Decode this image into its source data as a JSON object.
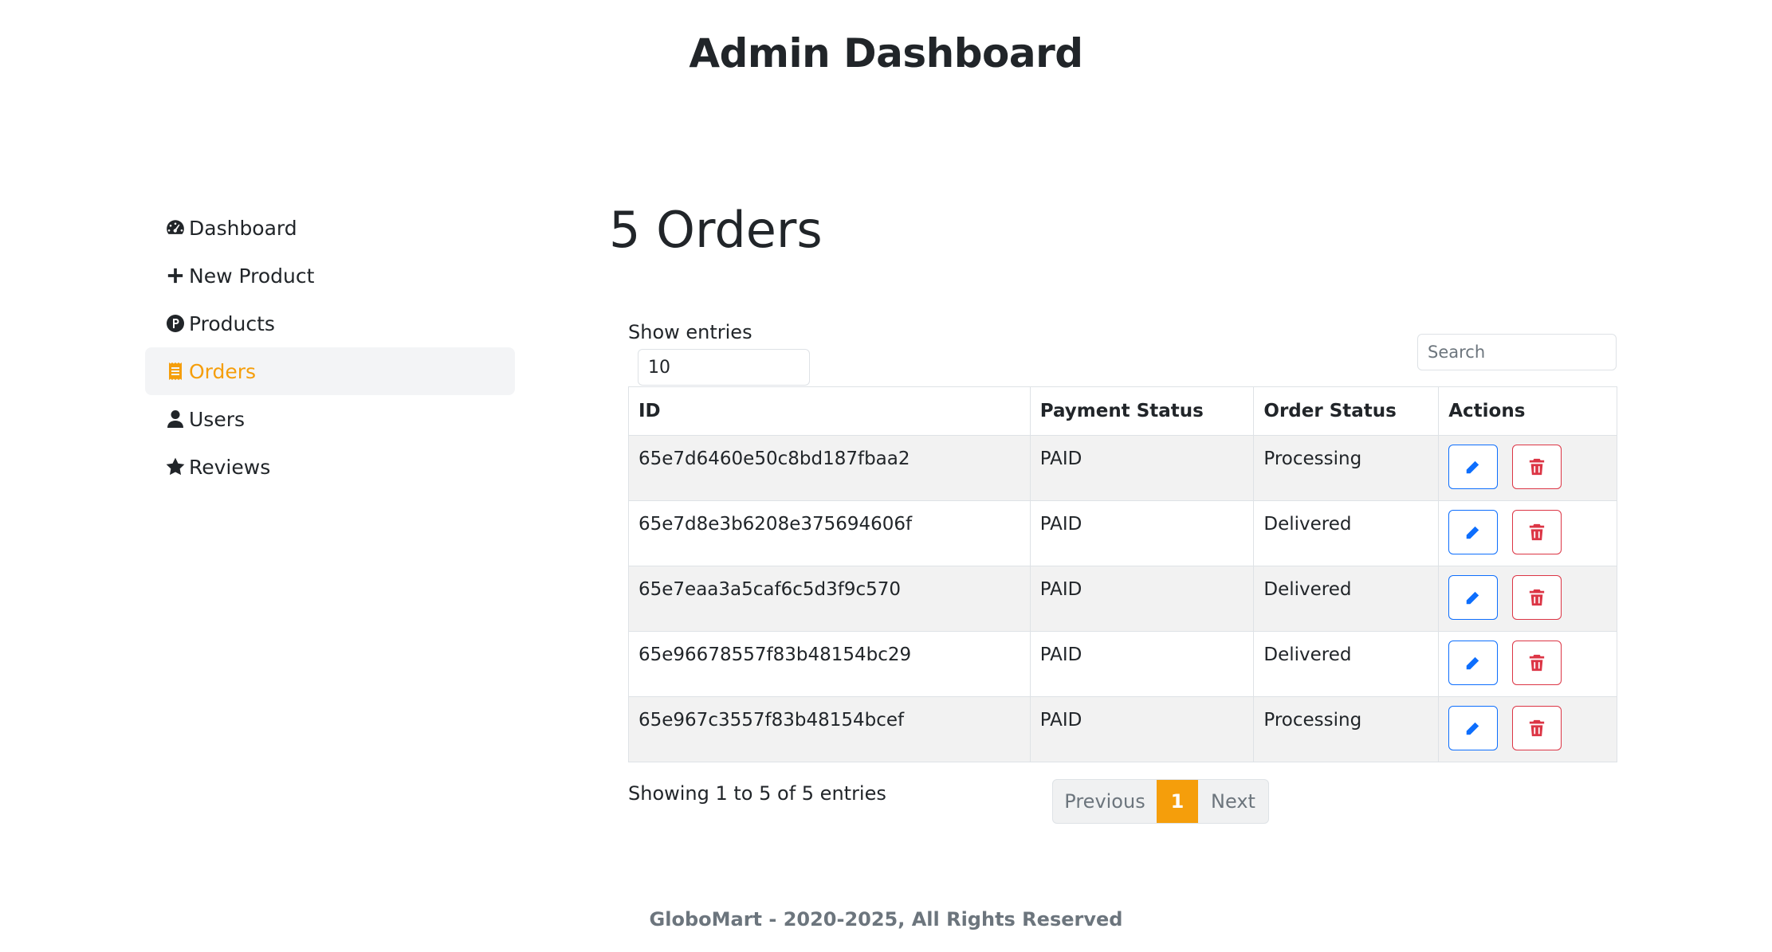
{
  "header": {
    "title": "Admin Dashboard"
  },
  "sidebar": {
    "items": [
      {
        "label": "Dashboard",
        "icon": "gauge-icon",
        "active": false
      },
      {
        "label": "New Product",
        "icon": "plus-icon",
        "active": false
      },
      {
        "label": "Products",
        "icon": "product-icon",
        "active": false
      },
      {
        "label": "Orders",
        "icon": "receipt-icon",
        "active": true
      },
      {
        "label": "Users",
        "icon": "user-icon",
        "active": false
      },
      {
        "label": "Reviews",
        "icon": "star-icon",
        "active": false
      }
    ]
  },
  "main": {
    "title": "5 Orders",
    "show_entries_label": "Show entries",
    "entries_value": "10",
    "search_placeholder": "Search",
    "table": {
      "headers": [
        "ID",
        "Payment Status",
        "Order Status",
        "Actions"
      ],
      "rows": [
        {
          "id": "65e7d6460e50c8bd187fbaa2",
          "payment": "PAID",
          "status": "Processing"
        },
        {
          "id": "65e7d8e3b6208e375694606f",
          "payment": "PAID",
          "status": "Delivered"
        },
        {
          "id": "65e7eaa3a5caf6c5d3f9c570",
          "payment": "PAID",
          "status": "Delivered"
        },
        {
          "id": "65e96678557f83b48154bc29",
          "payment": "PAID",
          "status": "Delivered"
        },
        {
          "id": "65e967c3557f83b48154bcef",
          "payment": "PAID",
          "status": "Processing"
        }
      ]
    },
    "info": "Showing 1 to 5 of 5 entries",
    "pagination": {
      "previous": "Previous",
      "current": "1",
      "next": "Next"
    }
  },
  "footer": {
    "text": "GloboMart - 2020-2025, All Rights Reserved"
  },
  "colors": {
    "accent": "#f59e0b",
    "edit": "#0d6efd",
    "delete": "#dc3545"
  }
}
